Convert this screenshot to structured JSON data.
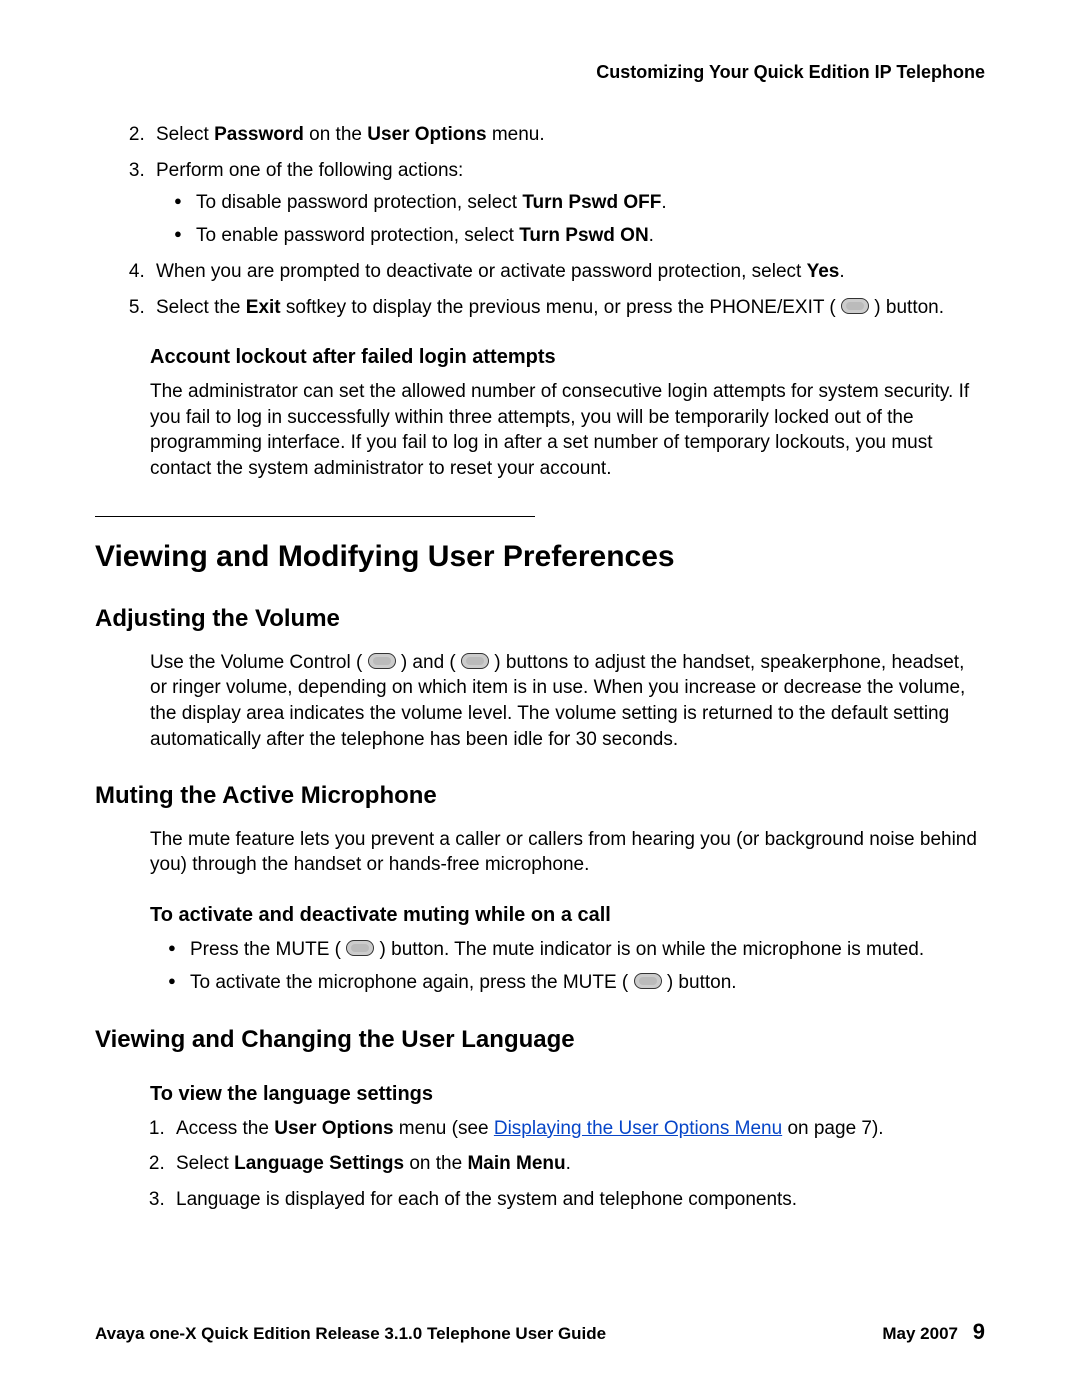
{
  "header": {
    "running": "Customizing Your Quick Edition IP Telephone"
  },
  "steps": {
    "s2": {
      "pre": "Select ",
      "b1": "Password",
      "mid": " on the ",
      "b2": "User Options",
      "post": " menu."
    },
    "s3": "Perform one of the following actions:",
    "s3b1": {
      "pre": "To disable password protection, select ",
      "b": "Turn Pswd OFF",
      "post": "."
    },
    "s3b2": {
      "pre": "To enable password protection, select ",
      "b": "Turn Pswd ON",
      "post": "."
    },
    "s4": {
      "pre": "When you are prompted to deactivate or activate password protection, select ",
      "b": "Yes",
      "post": "."
    },
    "s5": {
      "pre": "Select the ",
      "b": "Exit",
      "mid": " softkey to display the previous menu, or press the PHONE/EXIT ( ",
      "post": " ) button."
    }
  },
  "lockout": {
    "heading": "Account lockout after failed login attempts",
    "para": "The administrator can set the allowed number of consecutive login attempts for system security. If you fail to log in successfully within three attempts, you will be temporarily locked out of the programming interface. If you fail to log in after a set number of temporary lockouts, you must contact the system administrator to reset your account."
  },
  "section": {
    "title": "Viewing and Modifying User Preferences"
  },
  "volume": {
    "heading": "Adjusting the Volume",
    "p_pre": "Use the Volume Control ( ",
    "p_mid1": " ) and ( ",
    "p_mid2": " ) buttons to adjust the handset, speakerphone, headset, or ringer volume, depending on which item is in use. When you increase or decrease the volume, the display area indicates the volume level. The volume setting is returned to the default setting automatically after the telephone has been idle for 30 seconds."
  },
  "mute": {
    "heading": "Muting the Active Microphone",
    "para": "The mute feature lets you prevent a caller or callers from hearing you (or background noise behind you) through the handset or hands-free microphone.",
    "sub": "To activate and deactivate muting while on a call",
    "b1_pre": "Press the MUTE ( ",
    "b1_post": " ) button. The mute indicator is on while the microphone is muted.",
    "b2_pre": "To activate the microphone again, press the MUTE ( ",
    "b2_post": " ) button."
  },
  "lang": {
    "heading": "Viewing and Changing the User Language",
    "sub": "To view the language settings",
    "s1_pre": "Access the ",
    "s1_b": "User Options",
    "s1_mid": " menu (see ",
    "s1_link": "Displaying the User Options Menu",
    "s1_post": " on page 7).",
    "s2_pre": "Select ",
    "s2_b1": "Language Settings",
    "s2_mid": " on the ",
    "s2_b2": "Main Menu",
    "s2_post": ".",
    "s3": "Language is displayed for each of the system and telephone components."
  },
  "footer": {
    "left": "Avaya one-X Quick Edition Release 3.1.0 Telephone User Guide",
    "date": "May 2007",
    "page": "9"
  }
}
